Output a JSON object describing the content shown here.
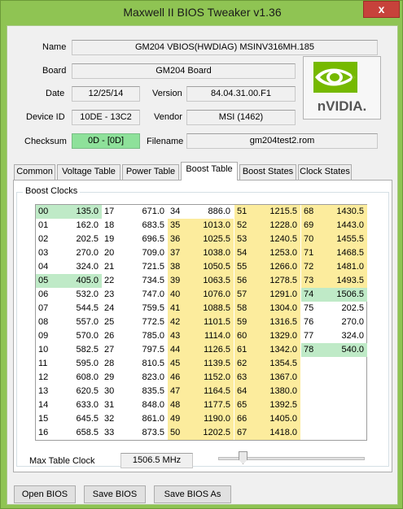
{
  "window": {
    "title": "Maxwell II BIOS Tweaker v1.36",
    "close_glyph": "x"
  },
  "info": {
    "name_label": "Name",
    "name_value": "GM204 VBIOS(HWDIAG) MSINV316MH.185",
    "board_label": "Board",
    "board_value": "GM204 Board",
    "date_label": "Date",
    "date_value": "12/25/14",
    "version_label": "Version",
    "version_value": "84.04.31.00.F1",
    "device_label": "Device ID",
    "device_value": "10DE - 13C2",
    "vendor_label": "Vendor",
    "vendor_value": "MSI (1462)",
    "checksum_label": "Checksum",
    "checksum_value": "0D - [0D]",
    "filename_label": "Filename",
    "filename_value": "gm204test2.rom"
  },
  "logo": {
    "text": "nVIDIA."
  },
  "tabs": [
    "Common",
    "Voltage Table",
    "Power Table",
    "Boost Table",
    "Boost States",
    "Clock States"
  ],
  "active_tab": 3,
  "boost": {
    "group_label": "Boost Clocks",
    "columns": [
      [
        [
          "00",
          "135.0",
          "g"
        ],
        [
          "01",
          "162.0",
          ""
        ],
        [
          "02",
          "202.5",
          ""
        ],
        [
          "03",
          "270.0",
          ""
        ],
        [
          "04",
          "324.0",
          ""
        ],
        [
          "05",
          "405.0",
          "g"
        ],
        [
          "06",
          "532.0",
          ""
        ],
        [
          "07",
          "544.5",
          ""
        ],
        [
          "08",
          "557.0",
          ""
        ],
        [
          "09",
          "570.0",
          ""
        ],
        [
          "10",
          "582.5",
          ""
        ],
        [
          "11",
          "595.0",
          ""
        ],
        [
          "12",
          "608.0",
          ""
        ],
        [
          "13",
          "620.5",
          ""
        ],
        [
          "14",
          "633.0",
          ""
        ],
        [
          "15",
          "645.5",
          ""
        ],
        [
          "16",
          "658.5",
          ""
        ]
      ],
      [
        [
          "17",
          "671.0",
          ""
        ],
        [
          "18",
          "683.5",
          ""
        ],
        [
          "19",
          "696.5",
          ""
        ],
        [
          "20",
          "709.0",
          ""
        ],
        [
          "21",
          "721.5",
          ""
        ],
        [
          "22",
          "734.5",
          ""
        ],
        [
          "23",
          "747.0",
          ""
        ],
        [
          "24",
          "759.5",
          ""
        ],
        [
          "25",
          "772.5",
          ""
        ],
        [
          "26",
          "785.0",
          ""
        ],
        [
          "27",
          "797.5",
          ""
        ],
        [
          "28",
          "810.5",
          ""
        ],
        [
          "29",
          "823.0",
          ""
        ],
        [
          "30",
          "835.5",
          ""
        ],
        [
          "31",
          "848.0",
          ""
        ],
        [
          "32",
          "861.0",
          ""
        ],
        [
          "33",
          "873.5",
          ""
        ]
      ],
      [
        [
          "34",
          "886.0",
          ""
        ],
        [
          "35",
          "1013.0",
          "y"
        ],
        [
          "36",
          "1025.5",
          "y"
        ],
        [
          "37",
          "1038.0",
          "y"
        ],
        [
          "38",
          "1050.5",
          "y"
        ],
        [
          "39",
          "1063.5",
          "y"
        ],
        [
          "40",
          "1076.0",
          "y"
        ],
        [
          "41",
          "1088.5",
          "y"
        ],
        [
          "42",
          "1101.5",
          "y"
        ],
        [
          "43",
          "1114.0",
          "y"
        ],
        [
          "44",
          "1126.5",
          "y"
        ],
        [
          "45",
          "1139.5",
          "y"
        ],
        [
          "46",
          "1152.0",
          "y"
        ],
        [
          "47",
          "1164.5",
          "y"
        ],
        [
          "48",
          "1177.5",
          "y"
        ],
        [
          "49",
          "1190.0",
          "y"
        ],
        [
          "50",
          "1202.5",
          "y"
        ]
      ],
      [
        [
          "51",
          "1215.5",
          "y"
        ],
        [
          "52",
          "1228.0",
          "y"
        ],
        [
          "53",
          "1240.5",
          "y"
        ],
        [
          "54",
          "1253.0",
          "y"
        ],
        [
          "55",
          "1266.0",
          "y"
        ],
        [
          "56",
          "1278.5",
          "y"
        ],
        [
          "57",
          "1291.0",
          "y"
        ],
        [
          "58",
          "1304.0",
          "y"
        ],
        [
          "59",
          "1316.5",
          "y"
        ],
        [
          "60",
          "1329.0",
          "y"
        ],
        [
          "61",
          "1342.0",
          "y"
        ],
        [
          "62",
          "1354.5",
          "y"
        ],
        [
          "63",
          "1367.0",
          "y"
        ],
        [
          "64",
          "1380.0",
          "y"
        ],
        [
          "65",
          "1392.5",
          "y"
        ],
        [
          "66",
          "1405.0",
          "y"
        ],
        [
          "67",
          "1418.0",
          "y"
        ]
      ],
      [
        [
          "68",
          "1430.5",
          "y"
        ],
        [
          "69",
          "1443.0",
          "y"
        ],
        [
          "70",
          "1455.5",
          "y"
        ],
        [
          "71",
          "1468.5",
          "y"
        ],
        [
          "72",
          "1481.0",
          "y"
        ],
        [
          "73",
          "1493.5",
          "y"
        ],
        [
          "74",
          "1506.5",
          "g"
        ],
        [
          "75",
          "202.5",
          ""
        ],
        [
          "76",
          "270.0",
          ""
        ],
        [
          "77",
          "324.0",
          ""
        ],
        [
          "78",
          "540.0",
          "g"
        ]
      ]
    ],
    "max_label": "Max Table Clock",
    "max_value": "1506.5 MHz",
    "slider_fraction": 0.15
  },
  "buttons": {
    "open": "Open BIOS",
    "save": "Save BIOS",
    "save_as": "Save BIOS As"
  },
  "colors": {
    "window_frame": "#8fc453",
    "yellow_cell": "#fcec9d",
    "green_cell": "#bfeac7",
    "checksum_green": "#8ee19a",
    "nvidia_green": "#76b900"
  }
}
